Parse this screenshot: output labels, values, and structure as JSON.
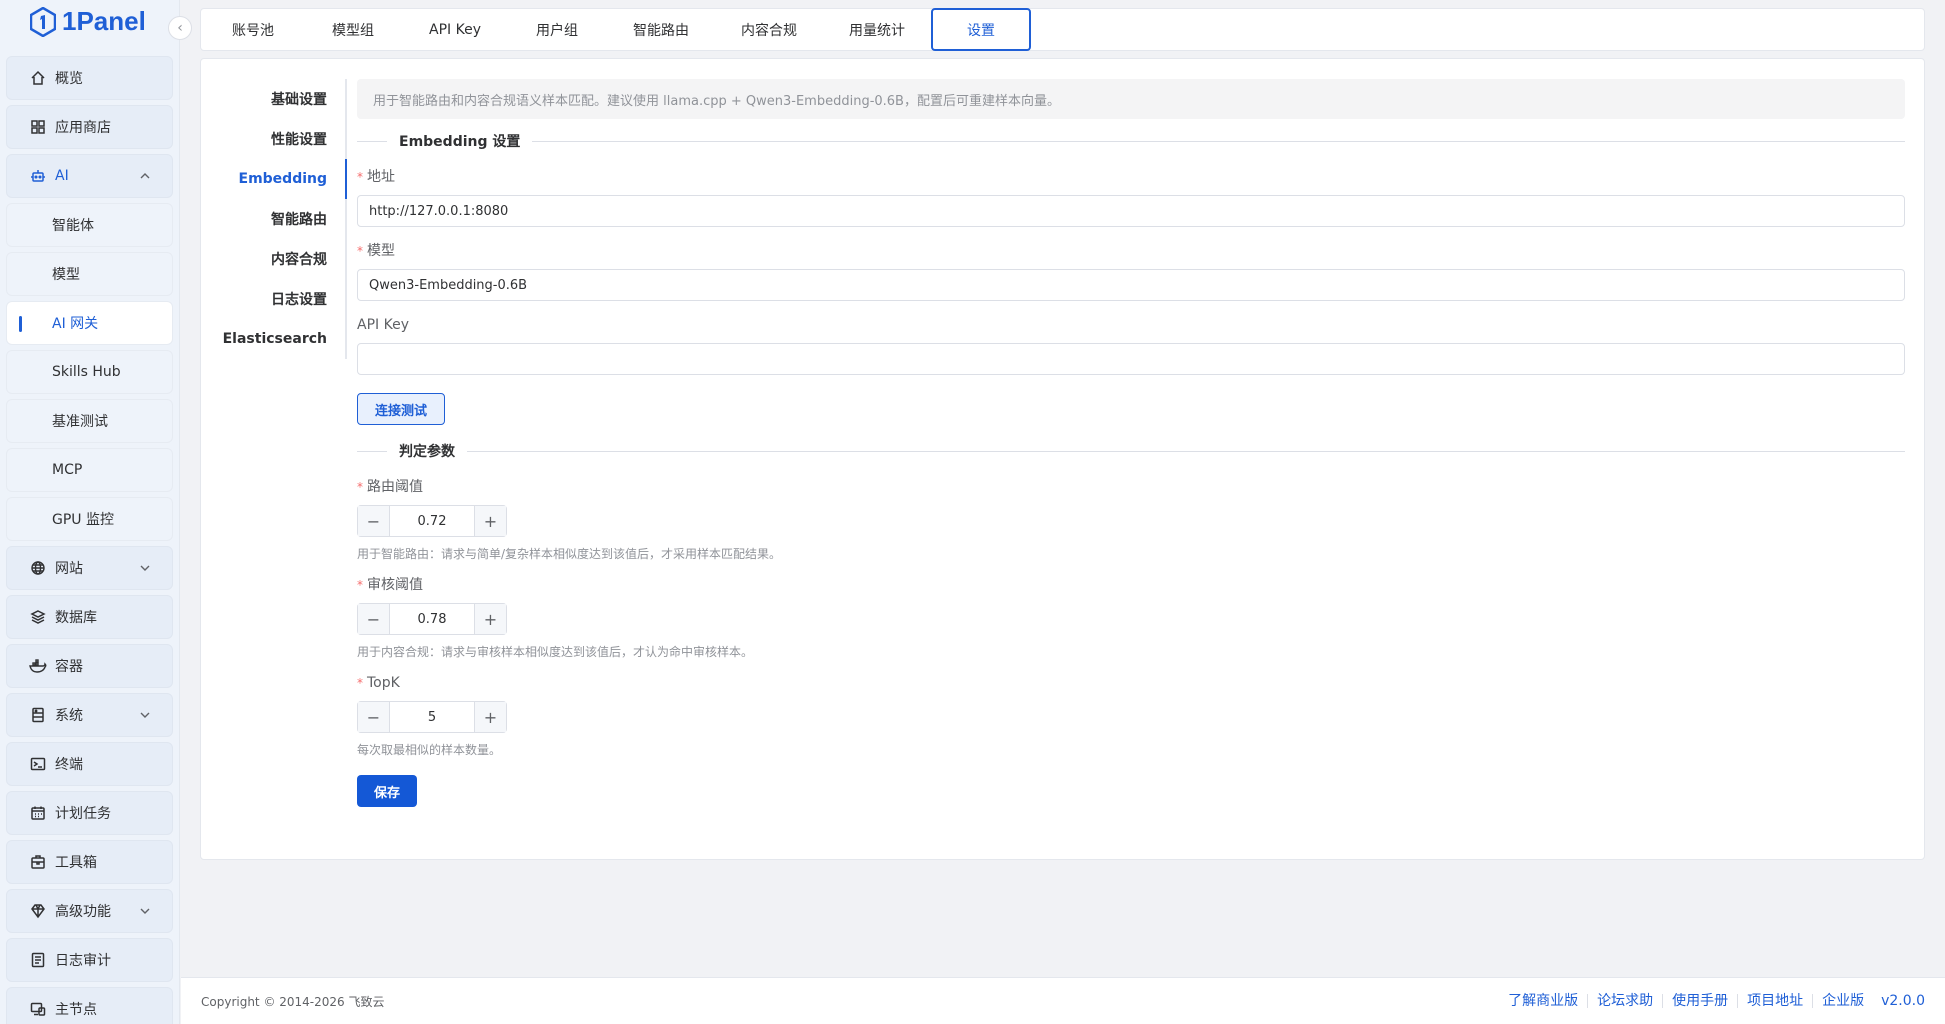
{
  "brand": {
    "name": "1Panel",
    "color": "#1f5fd6"
  },
  "sidebar": {
    "items": [
      {
        "label": "概览",
        "icon": "home-icon",
        "type": "top"
      },
      {
        "label": "应用商店",
        "icon": "grid-icon",
        "type": "top"
      },
      {
        "label": "AI",
        "icon": "robot-icon",
        "type": "open"
      },
      {
        "label": "智能体",
        "type": "sub"
      },
      {
        "label": "模型",
        "type": "sub"
      },
      {
        "label": "AI 网关",
        "type": "sub-active"
      },
      {
        "label": "Skills Hub",
        "type": "sub"
      },
      {
        "label": "基准测试",
        "type": "sub"
      },
      {
        "label": "MCP",
        "type": "sub"
      },
      {
        "label": "GPU 监控",
        "type": "sub"
      },
      {
        "label": "网站",
        "icon": "globe-icon",
        "type": "collapsed"
      },
      {
        "label": "数据库",
        "icon": "layers-icon",
        "type": "top"
      },
      {
        "label": "容器",
        "icon": "docker-icon",
        "type": "top"
      },
      {
        "label": "系统",
        "icon": "server-icon",
        "type": "collapsed"
      },
      {
        "label": "终端",
        "icon": "terminal-icon",
        "type": "top"
      },
      {
        "label": "计划任务",
        "icon": "calendar-icon",
        "type": "top"
      },
      {
        "label": "工具箱",
        "icon": "toolbox-icon",
        "type": "top"
      },
      {
        "label": "高级功能",
        "icon": "diamond-icon",
        "type": "collapsed"
      },
      {
        "label": "日志审计",
        "icon": "log-icon",
        "type": "top"
      },
      {
        "label": "主节点",
        "icon": "node-icon",
        "type": "top"
      }
    ]
  },
  "tabs": [
    "账号池",
    "模型组",
    "API Key",
    "用户组",
    "智能路由",
    "内容合规",
    "用量统计",
    "设置"
  ],
  "active_tab": "设置",
  "subnav": [
    "基础设置",
    "性能设置",
    "Embedding",
    "智能路由",
    "内容合规",
    "日志设置",
    "Elasticsearch"
  ],
  "active_subnav": "Embedding",
  "form": {
    "alert": "用于智能路由和内容合规语义样本匹配。建议使用 llama.cpp + Qwen3-Embedding-0.6B，配置后可重建样本向量。",
    "section1": "Embedding 设置",
    "address_label": "地址",
    "address_value": "http://127.0.0.1:8080",
    "model_label": "模型",
    "model_value": "Qwen3-Embedding-0.6B",
    "apikey_label": "API Key",
    "apikey_value": "",
    "test_button": "连接测试",
    "section2": "判定参数",
    "route_label": "路由阈值",
    "route_value": "0.72",
    "route_help": "用于智能路由：请求与简单/复杂样本相似度达到该值后，才采用样本匹配结果。",
    "audit_label": "审核阈值",
    "audit_value": "0.78",
    "audit_help": "用于内容合规：请求与审核样本相似度达到该值后，才认为命中审核样本。",
    "topk_label": "TopK",
    "topk_value": "5",
    "topk_help": "每次取最相似的样本数量。",
    "save_button": "保存"
  },
  "footer": {
    "copyright": "Copyright © 2014-2026 飞致云",
    "links": [
      "了解商业版",
      "论坛求助",
      "使用手册",
      "项目地址",
      "企业版"
    ],
    "version": "v2.0.0"
  }
}
